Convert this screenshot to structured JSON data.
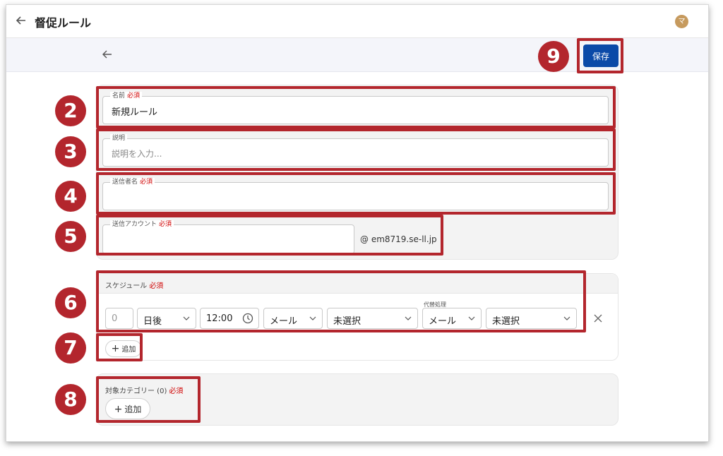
{
  "app": {
    "title": "督促ルール",
    "avatar_initial": "マ"
  },
  "toolbar": {
    "save_label": "保存"
  },
  "form": {
    "required_marker": "必須",
    "name": {
      "label": "名前",
      "value": "新規ルール"
    },
    "description": {
      "label": "説明",
      "placeholder": "説明を入力..."
    },
    "sender_name": {
      "label": "送信者名",
      "value": ""
    },
    "sender_account": {
      "label": "送信アカウント",
      "value": "",
      "domain": "@ em8719.se-ll.jp"
    }
  },
  "schedule": {
    "label": "スケジュール",
    "alt_label": "代替処理",
    "row": {
      "days": "0",
      "timing": "日後",
      "time": "12:00",
      "channel": "メール",
      "template": "未選択",
      "alt_channel": "メール",
      "alt_template": "未選択"
    },
    "add_label": "追加"
  },
  "categories": {
    "label": "対象カテゴリー (0)",
    "add_label": "追加"
  },
  "annotations": [
    "2",
    "3",
    "4",
    "5",
    "6",
    "7",
    "8",
    "9"
  ],
  "colors": {
    "accent": "#0b4aa8",
    "annotation": "#b3262d",
    "required": "#d00000",
    "avatar": "#c69a5e"
  }
}
